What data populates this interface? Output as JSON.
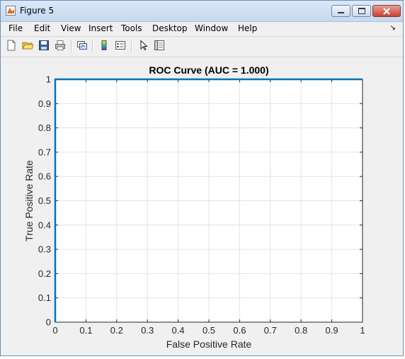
{
  "window": {
    "title": "Figure 5",
    "icon": "matlab-figure-icon"
  },
  "menu": {
    "items": [
      "File",
      "Edit",
      "View",
      "Insert",
      "Tools",
      "Desktop",
      "Window",
      "Help"
    ],
    "overflow_icon": "dock-arrow-icon"
  },
  "toolbar": {
    "icons": [
      "new-figure-icon",
      "open-file-icon",
      "save-icon",
      "print-icon",
      "link-plot-icon",
      "insert-colorbar-icon",
      "insert-legend-icon",
      "pointer-icon",
      "property-inspector-icon"
    ]
  },
  "colors": {
    "axes_border": "#0072bd",
    "grid": "#e3e3e3",
    "roc_line": "#0072bd"
  },
  "chart_data": {
    "type": "line",
    "title": "ROC Curve (AUC = 1.000)",
    "xlabel": "False Positive Rate",
    "ylabel": "True Positive Rate",
    "xlim": [
      0,
      1
    ],
    "ylim": [
      0,
      1
    ],
    "xticks": [
      "0",
      "0.1",
      "0.2",
      "0.3",
      "0.4",
      "0.5",
      "0.6",
      "0.7",
      "0.8",
      "0.9",
      "1"
    ],
    "yticks": [
      "0",
      "0.1",
      "0.2",
      "0.3",
      "0.4",
      "0.5",
      "0.6",
      "0.7",
      "0.8",
      "0.9",
      "1"
    ],
    "grid": true,
    "series": [
      {
        "x": [
          0,
          0,
          1
        ],
        "y": [
          0,
          1,
          1
        ],
        "color": "#0072bd"
      }
    ]
  }
}
